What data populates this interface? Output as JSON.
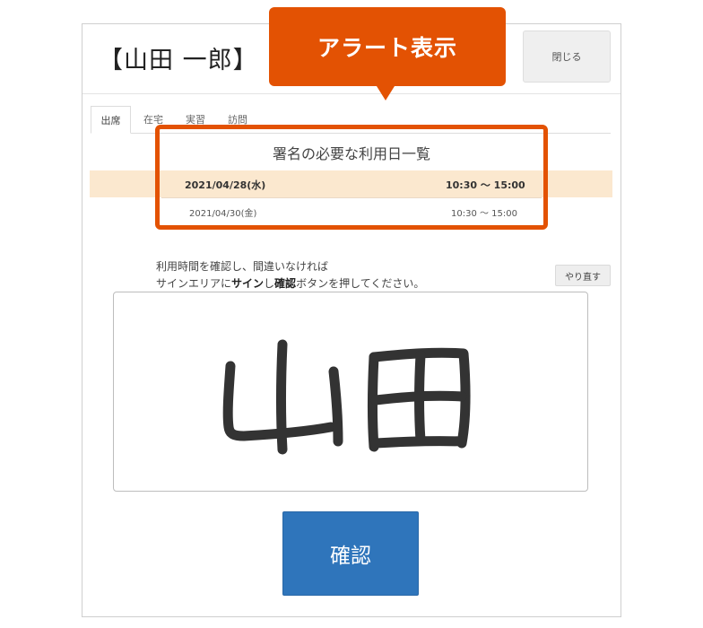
{
  "header": {
    "title": "【山田 一郎】",
    "close_label": "閉じる"
  },
  "tabs": [
    {
      "label": "出席",
      "active": true
    },
    {
      "label": "在宅",
      "active": false
    },
    {
      "label": "実習",
      "active": false
    },
    {
      "label": "訪問",
      "active": false
    }
  ],
  "alert": {
    "callout_label": "アラート表示",
    "color": "#e35203"
  },
  "signature_list": {
    "title": "署名の必要な利用日一覧",
    "rows": [
      {
        "date": "2021/04/28(水)",
        "time": "10:30 〜 15:00",
        "highlighted": true
      },
      {
        "date": "2021/04/30(金)",
        "time": "10:30 〜 15:00",
        "highlighted": false
      }
    ]
  },
  "instructions": {
    "line1": "利用時間を確認し、間違いなければ",
    "line2_part1": "サインエリアに",
    "line2_bold1": "サイン",
    "line2_part2": "し",
    "line2_bold2": "確認",
    "line2_part3": "ボタンを押してください。"
  },
  "redo_label": "やり直す",
  "confirm_label": "確認",
  "colors": {
    "accent": "#e35203",
    "primary_button": "#2f75bb",
    "row_highlight": "#fbe8cf"
  }
}
